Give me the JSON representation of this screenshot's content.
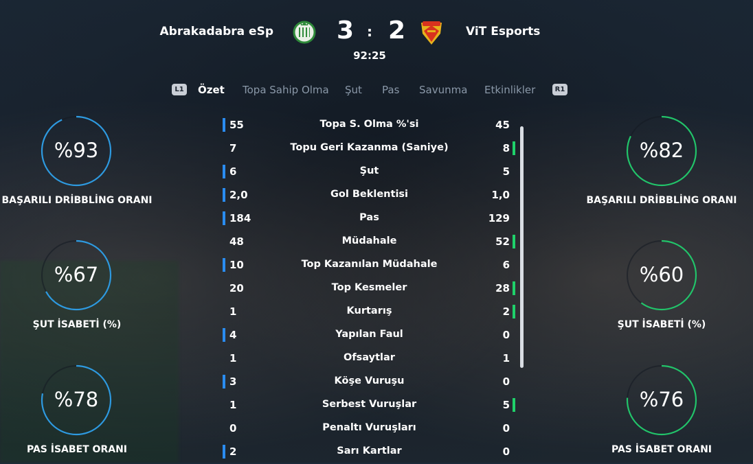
{
  "match": {
    "home_team": "Abrakadabra eSp",
    "away_team": "ViT Esports",
    "home_score": "3",
    "away_score": "2",
    "separator": ":",
    "clock": "92:25"
  },
  "tabs": {
    "left_button": "L1",
    "right_button": "R1",
    "items": [
      "Özet",
      "Topa Sahip Olma",
      "Şut",
      "Pas",
      "Savunma",
      "Etkinlikler"
    ],
    "active": "Özet"
  },
  "colors": {
    "home_accent": "#2a8cf0",
    "away_accent": "#1fd16a",
    "home_ring": "#2e9ae0",
    "away_ring": "#22c46a"
  },
  "home_panel": [
    {
      "value": "%93",
      "label": "BAŞARILI DRİBBLİNG ORANI",
      "percent": 93
    },
    {
      "value": "%67",
      "label": "ŞUT İSABETİ (%)",
      "percent": 67
    },
    {
      "value": "%78",
      "label": "PAS İSABET ORANI",
      "percent": 78
    }
  ],
  "away_panel": [
    {
      "value": "%82",
      "label": "BAŞARILI DRİBBLİNG ORANI",
      "percent": 82
    },
    {
      "value": "%60",
      "label": "ŞUT İSABETİ (%)",
      "percent": 60
    },
    {
      "value": "%76",
      "label": "PAS İSABET ORANI",
      "percent": 76
    }
  ],
  "stats": [
    {
      "label": "Topa S. Olma %'si",
      "home": "55",
      "away": "45",
      "leader": "home"
    },
    {
      "label": "Topu Geri Kazanma (Saniye)",
      "home": "7",
      "away": "8",
      "leader": "away"
    },
    {
      "label": "Şut",
      "home": "6",
      "away": "5",
      "leader": "home"
    },
    {
      "label": "Gol Beklentisi",
      "home": "2,0",
      "away": "1,0",
      "leader": "home"
    },
    {
      "label": "Pas",
      "home": "184",
      "away": "129",
      "leader": "home"
    },
    {
      "label": "Müdahale",
      "home": "48",
      "away": "52",
      "leader": "away"
    },
    {
      "label": "Top Kazanılan Müdahale",
      "home": "10",
      "away": "6",
      "leader": "home"
    },
    {
      "label": "Top Kesmeler",
      "home": "20",
      "away": "28",
      "leader": "away"
    },
    {
      "label": "Kurtarış",
      "home": "1",
      "away": "2",
      "leader": "away"
    },
    {
      "label": "Yapılan Faul",
      "home": "4",
      "away": "0",
      "leader": "home"
    },
    {
      "label": "Ofsaytlar",
      "home": "1",
      "away": "1",
      "leader": "none"
    },
    {
      "label": "Köşe Vuruşu",
      "home": "3",
      "away": "0",
      "leader": "home"
    },
    {
      "label": "Serbest Vuruşlar",
      "home": "1",
      "away": "5",
      "leader": "away"
    },
    {
      "label": "Penaltı Vuruşları",
      "home": "0",
      "away": "0",
      "leader": "none"
    },
    {
      "label": "Sarı Kartlar",
      "home": "2",
      "away": "0",
      "leader": "home"
    }
  ]
}
